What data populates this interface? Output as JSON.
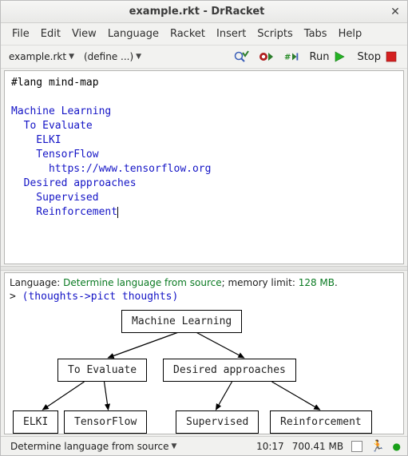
{
  "window": {
    "title": "example.rkt - DrRacket"
  },
  "menu": {
    "file": "File",
    "edit": "Edit",
    "view": "View",
    "language": "Language",
    "racket": "Racket",
    "insert": "Insert",
    "scripts": "Scripts",
    "tabs": "Tabs",
    "help": "Help"
  },
  "toolbar": {
    "tab_label": "example.rkt",
    "defs_label": "(define ...)",
    "run_label": "Run",
    "stop_label": "Stop"
  },
  "editor": {
    "lang_line_prefix": "#lang ",
    "lang_line_name": "mind-map",
    "lines": {
      "root": "Machine Learning",
      "eval": "  To Evaluate",
      "elki": "    ELKI",
      "tf": "    TensorFlow",
      "url": "      https://www.tensorflow.org",
      "desired": "  Desired approaches",
      "sup": "    Supervised",
      "rein": "    Reinforcement"
    }
  },
  "repl": {
    "lang_prefix": "Language: ",
    "lang_value": "Determine language from source",
    "mem_prefix": "; memory limit: ",
    "mem_value": "128 MB",
    "mem_suffix": ".",
    "prompt": "> ",
    "expr": "(thoughts->pict thoughts)"
  },
  "tree": {
    "root": "Machine Learning",
    "left": "To Evaluate",
    "right": "Desired approaches",
    "l1": "ELKI",
    "l2": "TensorFlow",
    "r1": "Supervised",
    "r2": "Reinforcement"
  },
  "status": {
    "lang": "Determine language from source",
    "pos": "10:17",
    "mem": "700.41 MB"
  }
}
